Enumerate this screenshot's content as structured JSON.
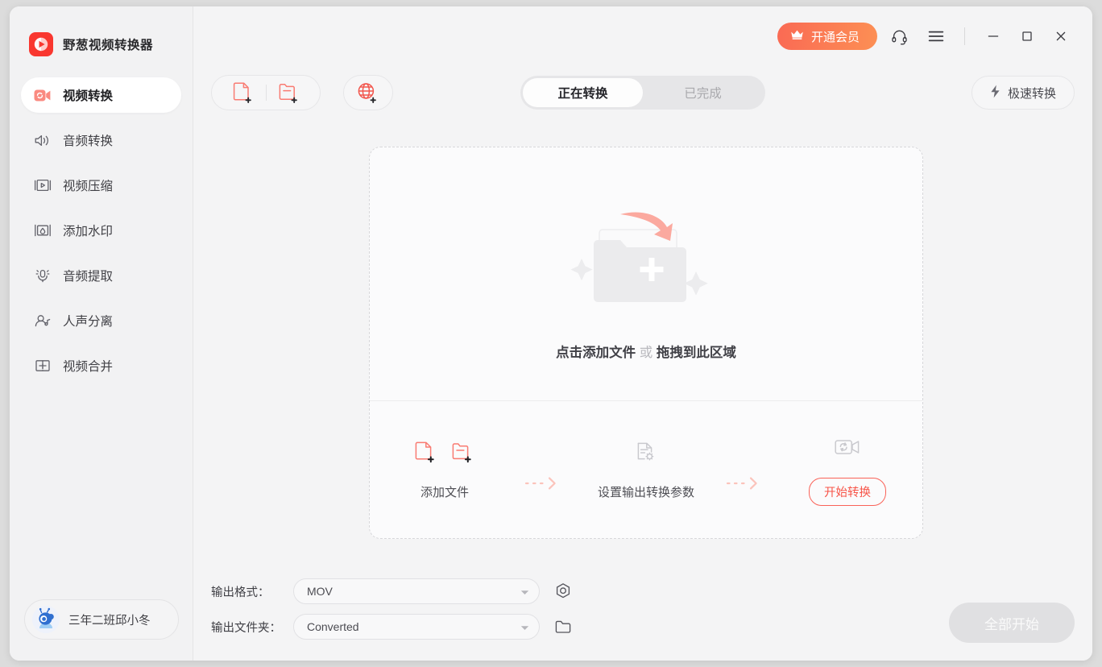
{
  "app": {
    "brand_name": "野葱视频转换器",
    "logo_color": "#f9372f"
  },
  "sidebar": {
    "items": [
      {
        "label": "视频转换",
        "icon": "video-convert-icon",
        "active": true
      },
      {
        "label": "音频转换",
        "icon": "audio-convert-icon",
        "active": false
      },
      {
        "label": "视频压缩",
        "icon": "video-compress-icon",
        "active": false
      },
      {
        "label": "添加水印",
        "icon": "watermark-icon",
        "active": false
      },
      {
        "label": "音频提取",
        "icon": "audio-extract-icon",
        "active": false
      },
      {
        "label": "人声分离",
        "icon": "vocal-separate-icon",
        "active": false
      },
      {
        "label": "视频合并",
        "icon": "video-merge-icon",
        "active": false
      }
    ],
    "user": {
      "name": "三年二班邱小冬",
      "avatar": "user-avatar"
    }
  },
  "titlebar": {
    "vip_label": "开通会员",
    "vip_icon": "crown-icon",
    "support_icon": "headset-icon",
    "menu_icon": "hamburger-menu-icon",
    "minimize_icon": "minimize-icon",
    "maximize_icon": "maximize-icon",
    "close_icon": "close-icon",
    "accent": "#fa6a54"
  },
  "toolbar": {
    "add_file_icon": "add-file-icon",
    "add_folder_icon": "add-folder-icon",
    "add_url_icon": "add-url-globe-icon",
    "tabs": [
      {
        "label": "正在转换",
        "active": true
      },
      {
        "label": "已完成",
        "active": false
      }
    ],
    "speed_label": "极速转换",
    "speed_icon": "lightning-bolt-icon"
  },
  "dropzone": {
    "illustration": "folder-with-arrow-illustration",
    "text_main": "点击添加文件",
    "text_or": "或",
    "text_drag": "拖拽到此区域",
    "steps": [
      {
        "label": "添加文件",
        "icons": [
          "add-file-icon",
          "add-folder-icon"
        ],
        "type": "icons"
      },
      {
        "label": "设置输出转换参数",
        "icons": [
          "document-settings-icon"
        ],
        "type": "icons"
      },
      {
        "label": "开始转换",
        "icons": [
          "video-convert-outline-icon"
        ],
        "type": "button"
      }
    ],
    "arrow_icon": "dotted-arrow-icon"
  },
  "bottom": {
    "format_label": "输出格式：",
    "format_value": "MOV",
    "format_settings_icon": "settings-gear-icon",
    "folder_label": "输出文件夹：",
    "folder_value": "Converted",
    "folder_browse_icon": "folder-open-icon",
    "start_all_label": "全部开始"
  }
}
